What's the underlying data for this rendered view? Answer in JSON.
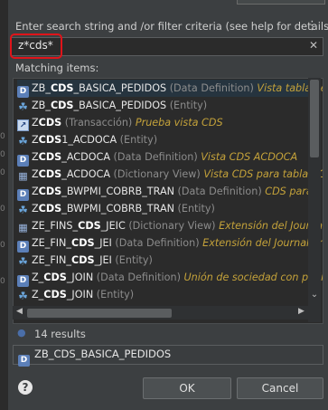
{
  "prompt": {
    "text": "Enter search string and /or filter criteria (see help for details)",
    "menu_icon": "more-vertical-icon"
  },
  "search": {
    "value": "z*cds*",
    "clear_icon": "close-icon"
  },
  "matching_label": "Matching items:",
  "items": [
    {
      "icon": "data-definition-icon",
      "pre": "ZB_",
      "bold": "CDS",
      "post": "_BASICA_PEDIDOS",
      "type": "(Data Definition)",
      "desc": "Vista tabla pedidos",
      "selected": true
    },
    {
      "icon": "entity-icon",
      "pre": "ZB_",
      "bold": "CDS",
      "post": "_BASICA_PEDIDOS",
      "type": "(Entity)",
      "desc": ""
    },
    {
      "icon": "transaction-icon",
      "pre": "Z",
      "bold": "CDS",
      "post": "",
      "type": "(Transacción)",
      "desc": "Prueba vista CDS"
    },
    {
      "icon": "entity-icon",
      "pre": "Z",
      "bold": "CDS",
      "post": "1_ACDOCA",
      "type": "(Entity)",
      "desc": ""
    },
    {
      "icon": "data-definition-icon",
      "pre": "Z",
      "bold": "CDS",
      "post": "_ACDOCA",
      "type": "(Data Definition)",
      "desc": "Vista CDS ACDOCA"
    },
    {
      "icon": "dictionary-view-icon",
      "pre": "Z",
      "bold": "CDS",
      "post": "_ACDOCA",
      "type": "(Dictionary View)",
      "desc": "Vista CDS para tabla ACDOCA"
    },
    {
      "icon": "data-definition-icon",
      "pre": "Z",
      "bold": "CDS",
      "post": "_BWPMI_COBRB_TRAN",
      "type": "(Data Definition)",
      "desc": "CDS para"
    },
    {
      "icon": "entity-icon",
      "pre": "Z",
      "bold": "CDS",
      "post": "_BWPMI_COBRB_TRAN",
      "type": "(Entity)",
      "desc": ""
    },
    {
      "icon": "dictionary-view-icon",
      "pre": "ZE_FINS_",
      "bold": "CDS",
      "post": "_JEIC",
      "type": "(Dictionary View)",
      "desc": "Extensión del Journal"
    },
    {
      "icon": "data-definition-icon",
      "pre": "ZE_FIN_",
      "bold": "CDS",
      "post": "_JEI",
      "type": "(Data Definition)",
      "desc": "Extensión del Journal en"
    },
    {
      "icon": "entity-icon",
      "pre": "ZE_FIN_",
      "bold": "CDS",
      "post": "_JEI",
      "type": "(Entity)",
      "desc": ""
    },
    {
      "icon": "data-definition-icon",
      "pre": "Z_",
      "bold": "CDS",
      "post": "_JOIN",
      "type": "(Data Definition)",
      "desc": "Unión de sociedad con pedidos"
    },
    {
      "icon": "entity-icon",
      "pre": "Z_",
      "bold": "CDS",
      "post": "_JOIN",
      "type": "(Entity)",
      "desc": ""
    }
  ],
  "results_label": "14 results",
  "detail": {
    "icon": "data-definition-icon",
    "text": "ZB_CDS_BASICA_PEDIDOS"
  },
  "buttons": {
    "help_icon": "help-icon",
    "ok": "OK",
    "cancel": "Cancel"
  }
}
